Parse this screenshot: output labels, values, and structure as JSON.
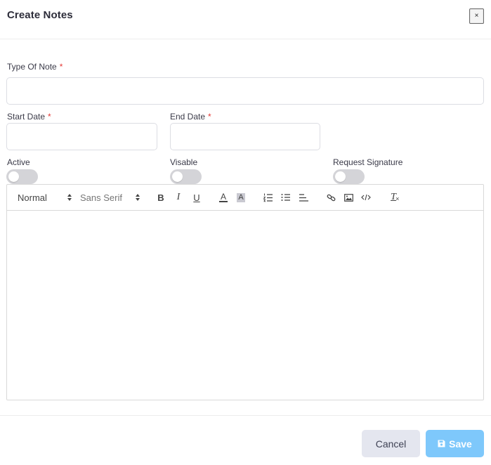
{
  "modal": {
    "title": "Create Notes",
    "close_label": "×"
  },
  "form": {
    "type_of_note": {
      "label": "Type Of Note",
      "required_mark": "*",
      "value": "",
      "placeholder": ""
    },
    "start_date": {
      "label": "Start Date",
      "required_mark": "*",
      "value": "",
      "placeholder": ""
    },
    "end_date": {
      "label": "End Date",
      "required_mark": "*",
      "value": "",
      "placeholder": ""
    },
    "toggles": [
      {
        "label": "Active",
        "checked": false
      },
      {
        "label": "Visable",
        "checked": false
      },
      {
        "label": "Request Signature",
        "checked": false
      }
    ]
  },
  "editor": {
    "header_picker": "Normal",
    "font_picker": "Sans Serif",
    "buttons": {
      "bold": "B",
      "italic": "I",
      "underline": "U",
      "color": "A",
      "background": "A",
      "clean": "T"
    },
    "content": ""
  },
  "footer": {
    "cancel_label": "Cancel",
    "save_label": "Save"
  },
  "colors": {
    "primary_save": "#7ec8fb",
    "cancel_bg": "#e4e6ef",
    "required": "#e53935",
    "toggle_off": "#d4d4d8"
  }
}
